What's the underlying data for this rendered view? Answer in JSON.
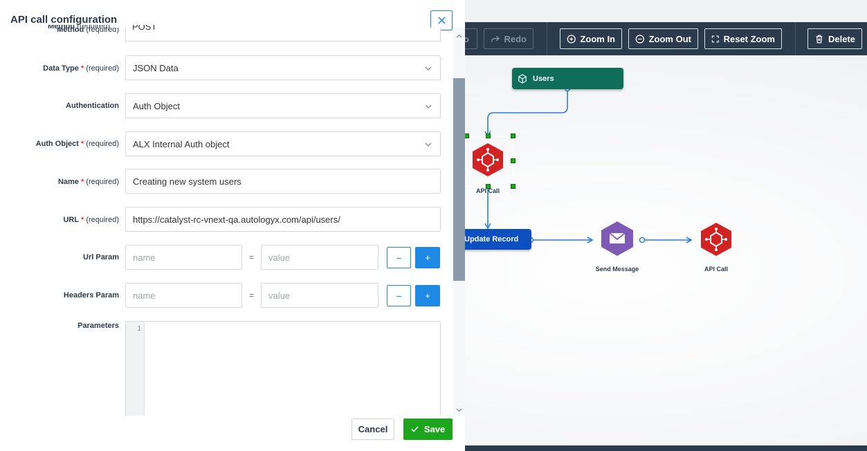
{
  "modal": {
    "title": "API call configuration",
    "fields": {
      "method": {
        "label": "Method",
        "required_text": "(required)",
        "value": "POST"
      },
      "data_type": {
        "label": "Data Type",
        "required_text": "(required)",
        "value": "JSON Data"
      },
      "authentication": {
        "label": "Authentication",
        "value": "Auth Object"
      },
      "auth_object": {
        "label": "Auth Object",
        "required_text": "(required)",
        "value": "ALX Internal Auth object"
      },
      "name": {
        "label": "Name",
        "required_text": "(required)",
        "value": "Creating new system users"
      },
      "url": {
        "label": "URL",
        "required_text": "(required)",
        "value": "https://catalyst-rc-vnext-qa.autologyx.com/api/users/"
      },
      "url_param": {
        "label": "Url  Param",
        "name_placeholder": "name",
        "value_placeholder": "value",
        "separator": "=",
        "minus_label": "−",
        "plus_label": "+"
      },
      "headers_param": {
        "label": "Headers  Param",
        "name_placeholder": "name",
        "value_placeholder": "value",
        "separator": "=",
        "minus_label": "−",
        "plus_label": "+"
      },
      "parameters": {
        "label": "Parameters",
        "line_number": "1"
      }
    },
    "required_star": "*",
    "footer": {
      "cancel_label": "Cancel",
      "save_label": "Save"
    }
  },
  "toolbar": {
    "undo_label": "o",
    "redo_label": "Redo",
    "zoom_in_label": "Zoom In",
    "zoom_out_label": "Zoom Out",
    "reset_zoom_label": "Reset Zoom",
    "delete_label": "Delete"
  },
  "workflow": {
    "nodes": {
      "users": "Users",
      "api_call_1": "API Call",
      "update_record": "Update Record",
      "send_message": "Send Message",
      "api_call_2": "API Call"
    }
  },
  "colors": {
    "toolbar_bg": "#2b3a4d",
    "accent_blue": "#1e88e5",
    "save_green": "#1ea51e",
    "users_node": "#0f6e5a",
    "update_record_node": "#0b4fc0",
    "api_call_node": "#d32222",
    "send_message_node": "#7e5ab5",
    "required_red": "#e53935"
  }
}
